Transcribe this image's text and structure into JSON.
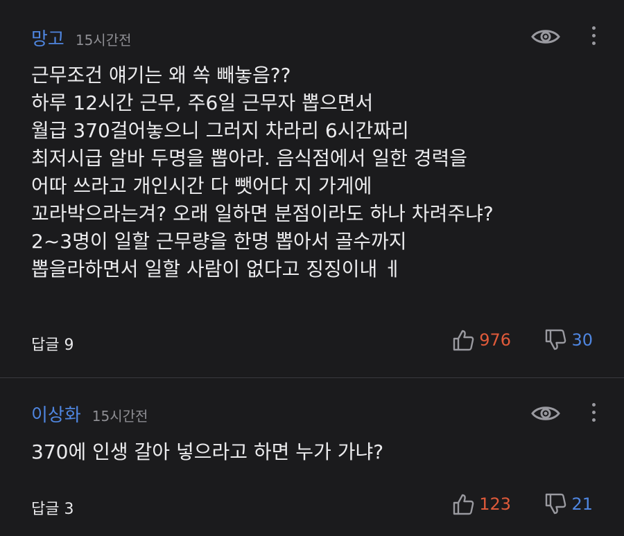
{
  "comments": [
    {
      "author": "망고",
      "time": "15시간전",
      "text": "근무조건 얘기는 왜 쏙 빼놓음??\n하루 12시간 근무, 주6일 근무자 뽑으면서\n월급 370걸어놓으니 그러지 차라리 6시간짜리\n최저시급 알바 두명을 뽑아라. 음식점에서 일한 경력을\n어따 쓰라고 개인시간 다 뺏어다 지 가게에\n꼬라박으라는겨? 오래 일하면 분점이라도 하나 차려주냐?\n2~3명이 일할 근무량을 한명 뽑아서 골수까지\n뽑을라하면서 일할 사람이 없다고 징징이내 ㅔ",
      "reply_label": "답글 9",
      "likes": "976",
      "dislikes": "30"
    },
    {
      "author": "이상화",
      "time": "15시간전",
      "text": "370에 인생 갈아 넣으라고 하면 누가 가냐?",
      "reply_label": "답글 3",
      "likes": "123",
      "dislikes": "21"
    }
  ],
  "colors": {
    "background": "#1b1b1d",
    "author": "#4f86e0",
    "like": "#e05a3a",
    "dislike": "#4f86e0"
  }
}
